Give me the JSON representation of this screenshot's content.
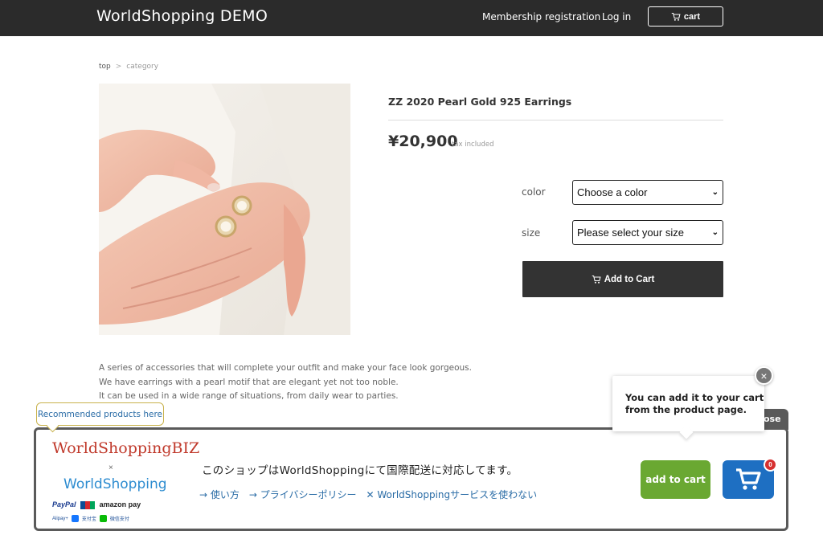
{
  "header": {
    "brand": "WorldShopping DEMO",
    "membership": "Membership registration",
    "login": "Log in",
    "cart": "cart"
  },
  "breadcrumb": {
    "top": "top",
    "separator": ">",
    "category": "category"
  },
  "product": {
    "title": "ZZ 2020 Pearl Gold 925 Earrings",
    "price": "¥20,900",
    "tax_note": "tax included",
    "color_label": "color",
    "color_select": "Choose a color",
    "size_label": "size",
    "size_select": "Please select your size",
    "add_to_cart": "Add to Cart",
    "description": [
      "A series of accessories that will complete your outfit and make your face look gorgeous.",
      "We have earrings with a pearl motif that are elegant yet not too noble.",
      "It can be used in a wide range of situations, from daily wear to parties."
    ]
  },
  "widget": {
    "recommended_tip": "Recommended products here",
    "close_tab": "ose",
    "hint_line1": "You can add it to your cart",
    "hint_line2": "from the product page.",
    "hint_close": "×",
    "logo_biz": "WorldShoppingBIZ",
    "logo_x": "×",
    "logo_ws": "WorldShopping",
    "pay_paypal": "PayPal",
    "pay_amazon": "amazon pay",
    "pay_small": [
      "Alipay+",
      "支付宝",
      "微信支付"
    ],
    "headline": "このショップはWorldShoppingにて国際配送に対応してます。",
    "links": [
      "→ 使い方",
      "→ プライバシーポリシー",
      "✕ WorldShoppingサービスを使わない"
    ],
    "add_to_cart": "add to cart",
    "cart_count": "0"
  },
  "colors": {
    "header_bg": "#2b2b2b",
    "button_dark": "#333333",
    "widget_green": "#6aa832",
    "widget_blue": "#1e6fc2",
    "badge_red": "#d63030",
    "link_blue": "#2a6ca6"
  }
}
